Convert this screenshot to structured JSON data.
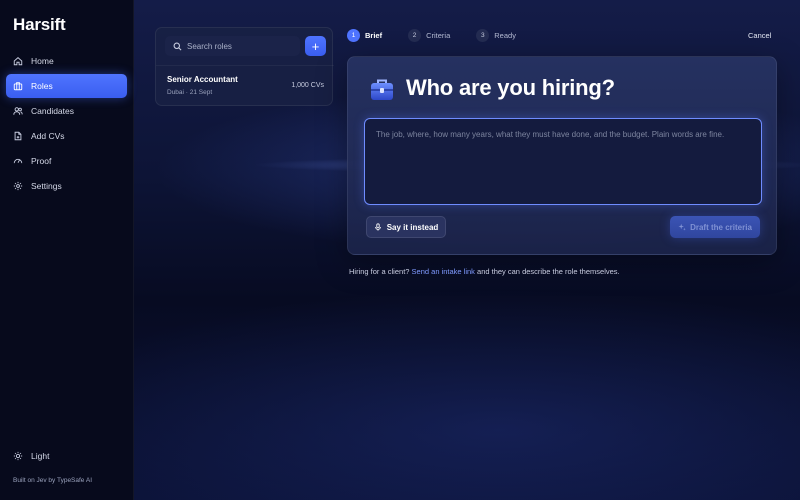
{
  "brand": "Harsift",
  "sidebar": {
    "items": [
      {
        "label": "Home",
        "icon": "home-icon",
        "active": false
      },
      {
        "label": "Roles",
        "icon": "briefcase-icon",
        "active": true
      },
      {
        "label": "Candidates",
        "icon": "users-icon",
        "active": false
      },
      {
        "label": "Add CVs",
        "icon": "file-add-icon",
        "active": false
      },
      {
        "label": "Proof",
        "icon": "gauge-icon",
        "active": false
      },
      {
        "label": "Settings",
        "icon": "gear-icon",
        "active": false
      }
    ],
    "theme_label": "Light",
    "footer": "Built on Jev by TypeSafe AI"
  },
  "roles": {
    "search_placeholder": "Search roles",
    "add_label": "+",
    "list": [
      {
        "title": "Senior Accountant",
        "meta": "Dubai · 21 Sept",
        "count": "1,000 CVs"
      }
    ]
  },
  "steps": [
    {
      "num": "1",
      "label": "Brief",
      "active": true
    },
    {
      "num": "2",
      "label": "Criteria",
      "active": false
    },
    {
      "num": "3",
      "label": "Ready",
      "active": false
    }
  ],
  "cancel_label": "Cancel",
  "brief": {
    "title": "Who are you hiring?",
    "placeholder": "The job, where, how many years, what they must have done, and the budget. Plain words are fine.",
    "say_label": "Say it instead",
    "draft_label": "Draft the criteria"
  },
  "client_note": {
    "prefix": "Hiring for a client?",
    "link": "Send an intake link",
    "suffix": "and they can describe the role themselves."
  },
  "colors": {
    "accent": "#4f74ff",
    "link": "#7f9bff",
    "sidebar_bg": "#070a1c",
    "page_bg": "#0a0f26"
  }
}
